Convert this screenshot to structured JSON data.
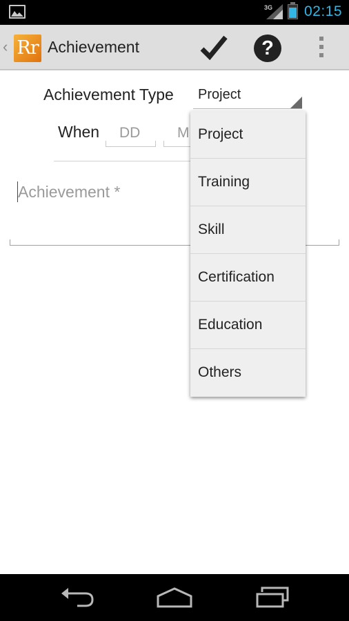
{
  "status_bar": {
    "network": "3G",
    "time": "02:15",
    "battery_level": 0.75,
    "icons": [
      "gallery-icon",
      "signal-icon",
      "battery-icon"
    ]
  },
  "action_bar": {
    "logo_text": "Rr",
    "title": "Achievement",
    "help_label": "?",
    "icons": [
      "up-caret-icon",
      "checkmark-icon",
      "help-icon",
      "overflow-menu-icon"
    ]
  },
  "form": {
    "type_label": "Achievement Type",
    "type_value": "Project",
    "when_label": "When",
    "day_placeholder": "DD",
    "month_placeholder": "M",
    "achievement_placeholder": "Achievement *"
  },
  "dropdown": {
    "options": [
      {
        "label": "Project"
      },
      {
        "label": "Training"
      },
      {
        "label": "Skill"
      },
      {
        "label": "Certification"
      },
      {
        "label": "Education"
      },
      {
        "label": "Others"
      }
    ]
  },
  "nav_bar": {
    "icons": [
      "back-icon",
      "home-icon",
      "recent-apps-icon"
    ]
  },
  "colors": {
    "accent": "#33b5e5",
    "logo": "#e8891f",
    "action_bar": "#dedede"
  }
}
